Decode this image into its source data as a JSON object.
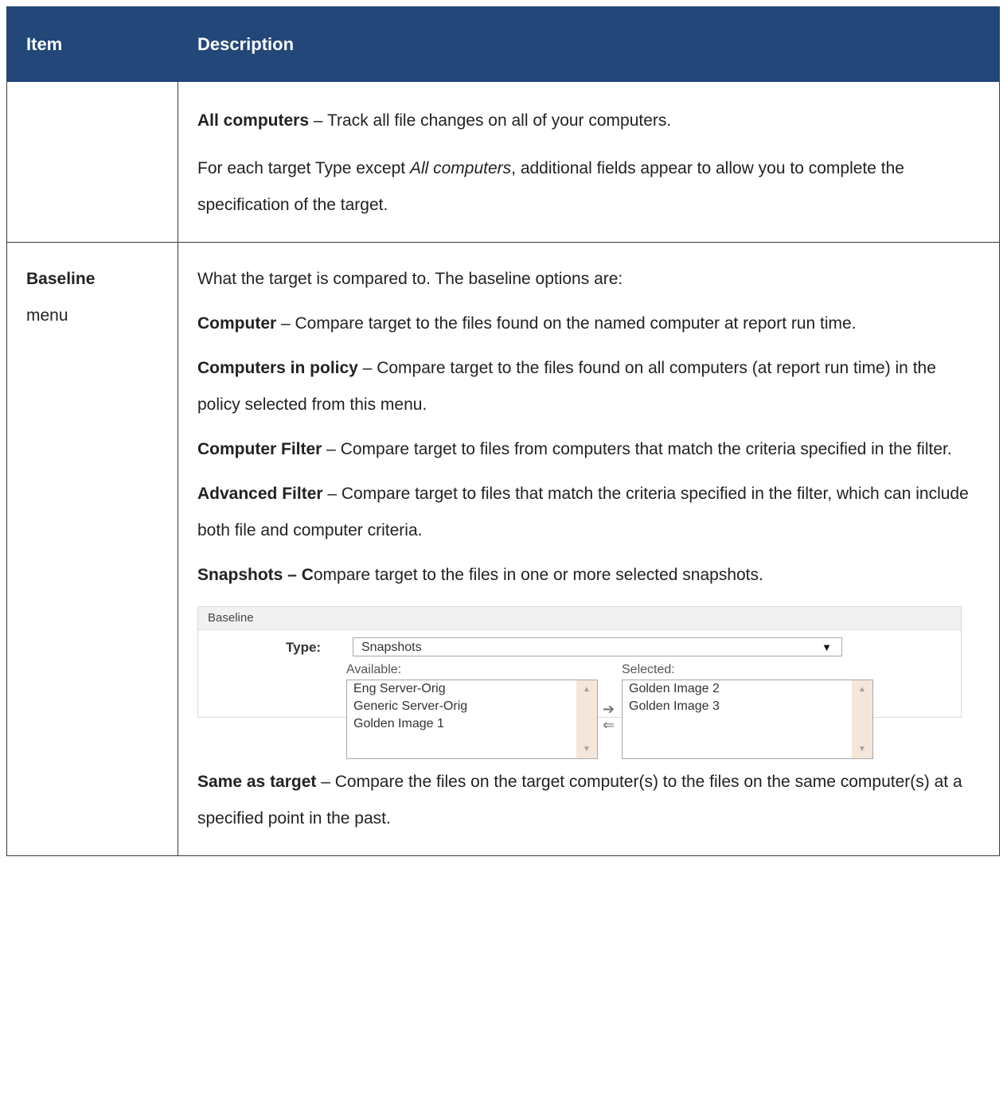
{
  "header": {
    "col_item": "Item",
    "col_description": "Description"
  },
  "row1": {
    "item": "",
    "p1_bold": "All computers",
    "p1_rest": " – Track all file changes on all of your computers.",
    "p2_before": "For each target Type except ",
    "p2_italic": "All computers",
    "p2_after": ", additional fields appear to allow you to complete the specification of the target."
  },
  "row2": {
    "item_title": "Baseline",
    "item_sub": "menu",
    "intro": "What the target is compared to. The baseline options are:",
    "options": [
      {
        "bold": "Computer",
        "text": " – Compare target to the files found on the named computer at report run time."
      },
      {
        "bold": "Computers in policy",
        "text": " – Compare target to the files found on all computers (at report run time) in the policy selected from this menu."
      },
      {
        "bold": "Computer Filter",
        "text": " – Compare target to files from computers that match the criteria specified in the filter."
      },
      {
        "bold": "Advanced Filter",
        "text": " – Compare target to files that match the criteria specified in the filter, which can include both file and computer criteria."
      },
      {
        "bold": "Snapshots – C",
        "text": "ompare target to the files in one or more selected snapshots."
      }
    ],
    "last_option": {
      "bold": "Same as target",
      "text": " – Compare the files on the target computer(s) to the files on the same computer(s) at a specified point in the past."
    }
  },
  "screenshot": {
    "panel_title": "Baseline",
    "type_label": "Type:",
    "type_value": "Snapshots",
    "available_label": "Available:",
    "selected_label": "Selected:",
    "available_items": [
      "Eng Server-Orig",
      "Generic Server-Orig",
      "Golden Image 1"
    ],
    "selected_items": [
      "Golden Image 2",
      "Golden Image 3"
    ],
    "move_right_glyph": "➔",
    "move_left_glyph": "⇐"
  }
}
